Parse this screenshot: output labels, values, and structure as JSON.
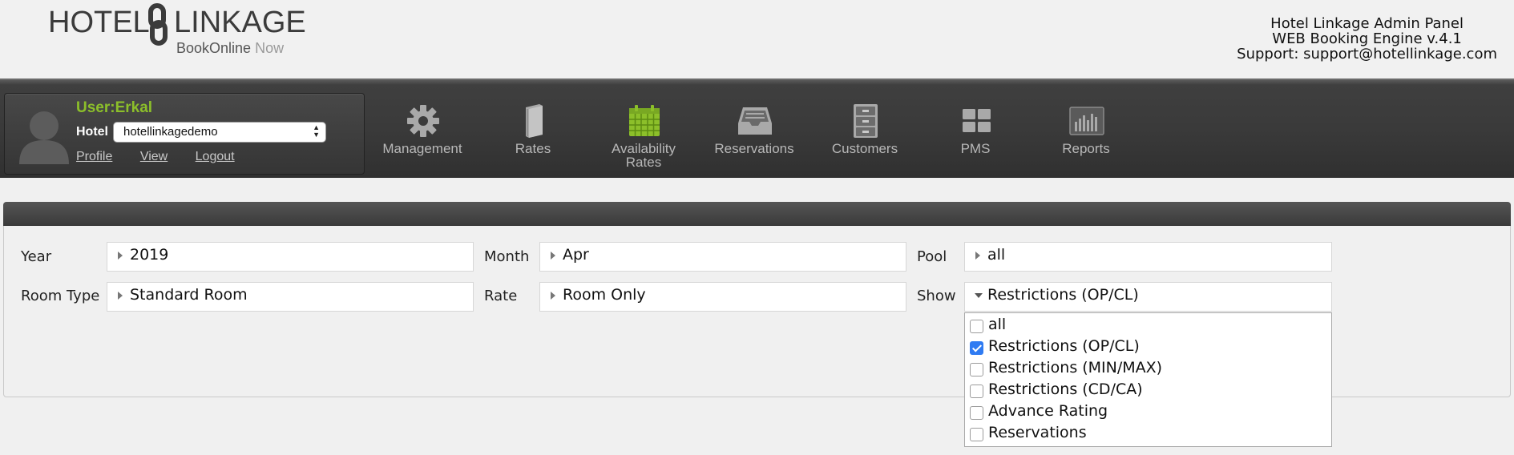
{
  "header": {
    "logo": {
      "word1": "HOTEL",
      "word2": "LINKAGE",
      "tagline_1": "BookOnline",
      "tagline_2": "Now"
    },
    "info": {
      "line1": "Hotel Linkage Admin Panel",
      "line2": "WEB Booking Engine v.4.1",
      "line3": "Support: support@hotellinkage.com"
    }
  },
  "user_panel": {
    "user": "User:Erkal",
    "hotel_label": "Hotel",
    "hotel_value": "hotellinkagedemo",
    "links": {
      "profile": "Profile",
      "view": "View",
      "logout": "Logout"
    }
  },
  "nav": [
    {
      "label": "Management",
      "icon": "gear-icon"
    },
    {
      "label": "Rates",
      "icon": "book-icon"
    },
    {
      "label": "Availability Rates",
      "icon": "calendar-icon",
      "accent": "#8cbf2a"
    },
    {
      "label": "Reservations",
      "icon": "inbox-tray-icon"
    },
    {
      "label": "Customers",
      "icon": "filing-cabinet-icon"
    },
    {
      "label": "PMS",
      "icon": "grid-tiles-icon"
    },
    {
      "label": "Reports",
      "icon": "bar-chart-icon"
    }
  ],
  "filters": {
    "year": {
      "label": "Year",
      "value": "2019"
    },
    "month": {
      "label": "Month",
      "value": "Apr"
    },
    "pool": {
      "label": "Pool",
      "value": "all"
    },
    "room_type": {
      "label": "Room Type",
      "value": "Standard Room"
    },
    "rate": {
      "label": "Rate",
      "value": "Room Only"
    },
    "show": {
      "label": "Show",
      "value": "Restrictions (OP/CL)",
      "expanded": true,
      "options": [
        {
          "label": "all",
          "checked": false
        },
        {
          "label": "Restrictions (OP/CL)",
          "checked": true
        },
        {
          "label": "Restrictions (MIN/MAX)",
          "checked": false
        },
        {
          "label": "Restrictions (CD/CA)",
          "checked": false
        },
        {
          "label": "Advance Rating",
          "checked": false
        },
        {
          "label": "Reservations",
          "checked": false
        }
      ]
    }
  },
  "colors": {
    "accent_green": "#8cbf2a",
    "checkbox_blue": "#2f7bf2"
  }
}
